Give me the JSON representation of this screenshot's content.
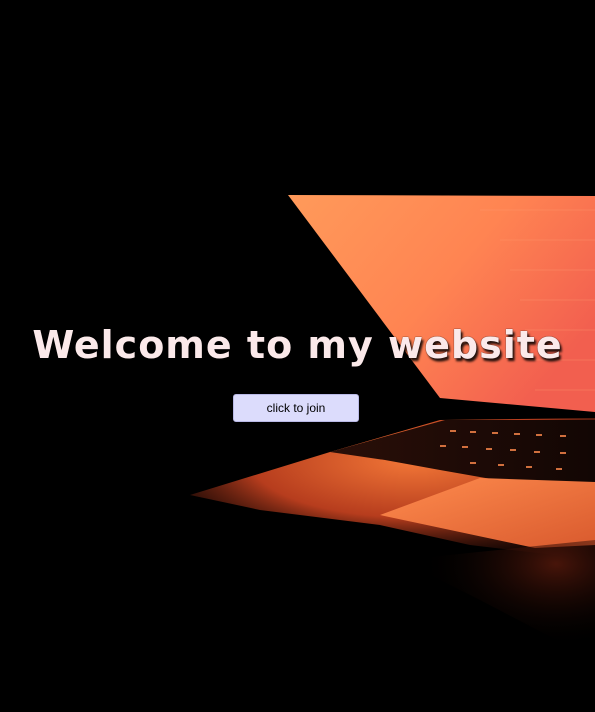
{
  "hero": {
    "title": "Welcome to my website",
    "button_label": "click to join",
    "background_image": "laptop-glowing-orange-screen",
    "colors": {
      "background": "#000000",
      "screen_glow": "#ff8a4d",
      "title_text": "#fbe9ea",
      "button_bg": "#dcdcfc"
    }
  }
}
